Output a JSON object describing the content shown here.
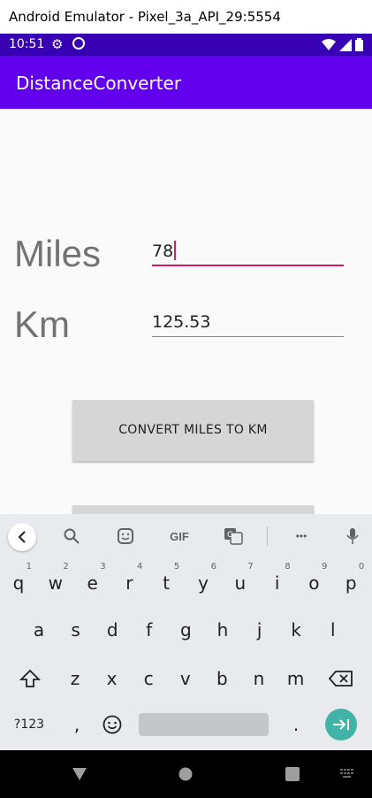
{
  "window": {
    "title": "Android Emulator - Pixel_3a_API_29:5554"
  },
  "status_bar": {
    "time": "10:51"
  },
  "app_bar": {
    "title": "DistanceConverter"
  },
  "form": {
    "miles_label": "Miles",
    "miles_value": "78",
    "km_label": "Km",
    "km_value": "125.53",
    "convert_button": "CONVERT MILES TO KM"
  },
  "keyboard": {
    "toolbar": {
      "gif_label": "GIF",
      "more_label": "•••"
    },
    "row1": [
      {
        "key": "q",
        "hint": "1"
      },
      {
        "key": "w",
        "hint": "2"
      },
      {
        "key": "e",
        "hint": "3"
      },
      {
        "key": "r",
        "hint": "4"
      },
      {
        "key": "t",
        "hint": "5"
      },
      {
        "key": "y",
        "hint": "6"
      },
      {
        "key": "u",
        "hint": "7"
      },
      {
        "key": "i",
        "hint": "8"
      },
      {
        "key": "o",
        "hint": "9"
      },
      {
        "key": "p",
        "hint": "0"
      }
    ],
    "row2": [
      "a",
      "s",
      "d",
      "f",
      "g",
      "h",
      "j",
      "k",
      "l"
    ],
    "row3": [
      "z",
      "x",
      "c",
      "v",
      "b",
      "n",
      "m"
    ],
    "row4": {
      "symbols": "?123",
      "comma": ",",
      "period": "."
    }
  },
  "colors": {
    "app_bar": "#6200ee",
    "status_bar": "#3700b3",
    "accent": "#d81b60",
    "enter": "#42b3a7"
  }
}
